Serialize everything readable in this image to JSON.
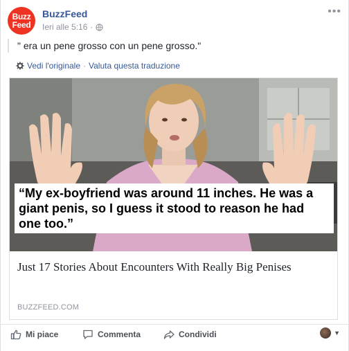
{
  "header": {
    "avatar_line1": "Buzz",
    "avatar_line2": "Feed",
    "page_name": "BuzzFeed",
    "timestamp": "Ieri alle 5:16",
    "separator": "·",
    "more_label": "•••"
  },
  "post": {
    "text": "\" era un pene grosso con un pene grosso.\""
  },
  "translation": {
    "see_original": "Vedi l'originale",
    "separator": "·",
    "rate_translation": "Valuta questa traduzione"
  },
  "card": {
    "caption": "“My ex-boyfriend was around 11 inches. He was a giant penis, so I guess it stood to reason he had one too.”",
    "title": "Just 17 Stories About Encounters With Really Big Penises",
    "domain": "BUZZFEED.COM"
  },
  "actions": {
    "like": "Mi piace",
    "comment": "Commenta",
    "share": "Condividi"
  },
  "colors": {
    "brand_red": "#ee3322",
    "link_blue": "#365899",
    "muted": "#90949c"
  }
}
